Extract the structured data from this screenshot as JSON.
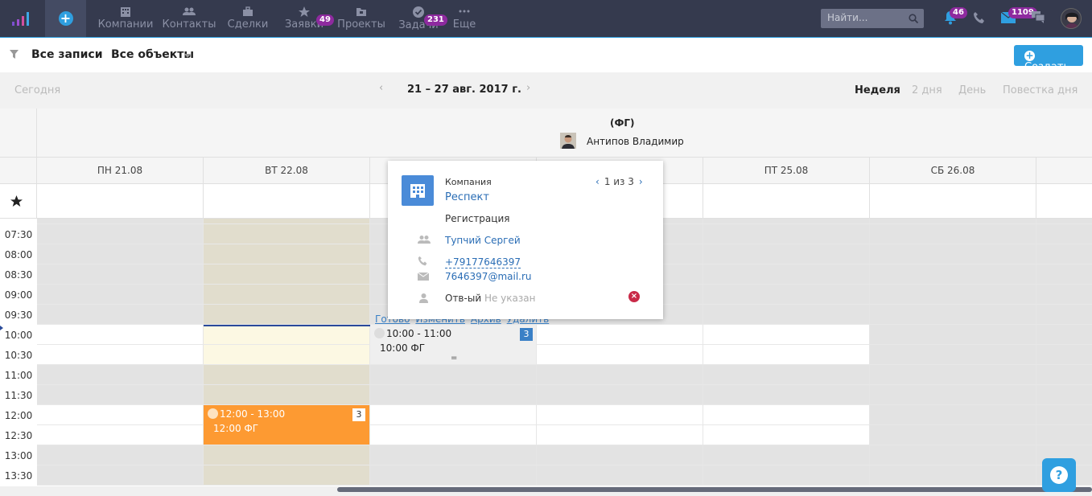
{
  "nav": {
    "items": [
      {
        "label": "Компании",
        "icon": "building-icon"
      },
      {
        "label": "Контакты",
        "icon": "contacts-icon"
      },
      {
        "label": "Сделки",
        "icon": "briefcase-icon"
      },
      {
        "label": "Заявки",
        "icon": "star-icon",
        "badge": "49"
      },
      {
        "label": "Проекты",
        "icon": "projects-icon"
      },
      {
        "label": "Задачи",
        "icon": "check-icon",
        "badge": "231"
      },
      {
        "label": "Еще",
        "icon": "more-icon"
      }
    ],
    "search_placeholder": "Найти...",
    "notifications_badge": "46",
    "messages_badge": "1109"
  },
  "filter": {
    "records": "Все записи",
    "objects": "Все объекты",
    "create": "Создать"
  },
  "datebar": {
    "today": "Сегодня",
    "range": "21 – 27 авг. 2017 г.",
    "views": [
      "Неделя",
      "2 дня",
      "День",
      "Повестка дня"
    ]
  },
  "group": {
    "title": "(ФГ)",
    "person": "Антипов Владимир"
  },
  "days": [
    "ПН 21.08",
    "ВТ 22.08",
    "",
    "",
    "ПТ 25.08",
    "СБ 26.08"
  ],
  "times": [
    "07:30",
    "08:00",
    "08:30",
    "09:00",
    "09:30",
    "10:00",
    "10:30",
    "11:00",
    "11:30",
    "12:00",
    "12:30",
    "13:00",
    "13:30"
  ],
  "events": {
    "orange": {
      "time": "12:00 - 13:00",
      "name": "12:00 ФГ",
      "count": "3"
    },
    "gray": {
      "time": "10:00 - 11:00",
      "name": "10:00 ФГ",
      "count": "3"
    }
  },
  "event_actions": [
    "Готово",
    "Изменить",
    "Архив",
    "Удалить"
  ],
  "popup": {
    "type": "Компания",
    "company": "Респект",
    "pager": "1 из 3",
    "stage": "Регистрация",
    "contact": "Тупчий Сергей",
    "phone": "+79177646397",
    "email": "7646397@mail.ru",
    "resp_label": "Отв-ый",
    "resp_value": "Не указан"
  },
  "colors": {
    "nav_bg": "#353a4e",
    "accent": "#2f9fe0",
    "event_orange": "#fd9a32",
    "badge_purple": "#8e2a9f"
  }
}
